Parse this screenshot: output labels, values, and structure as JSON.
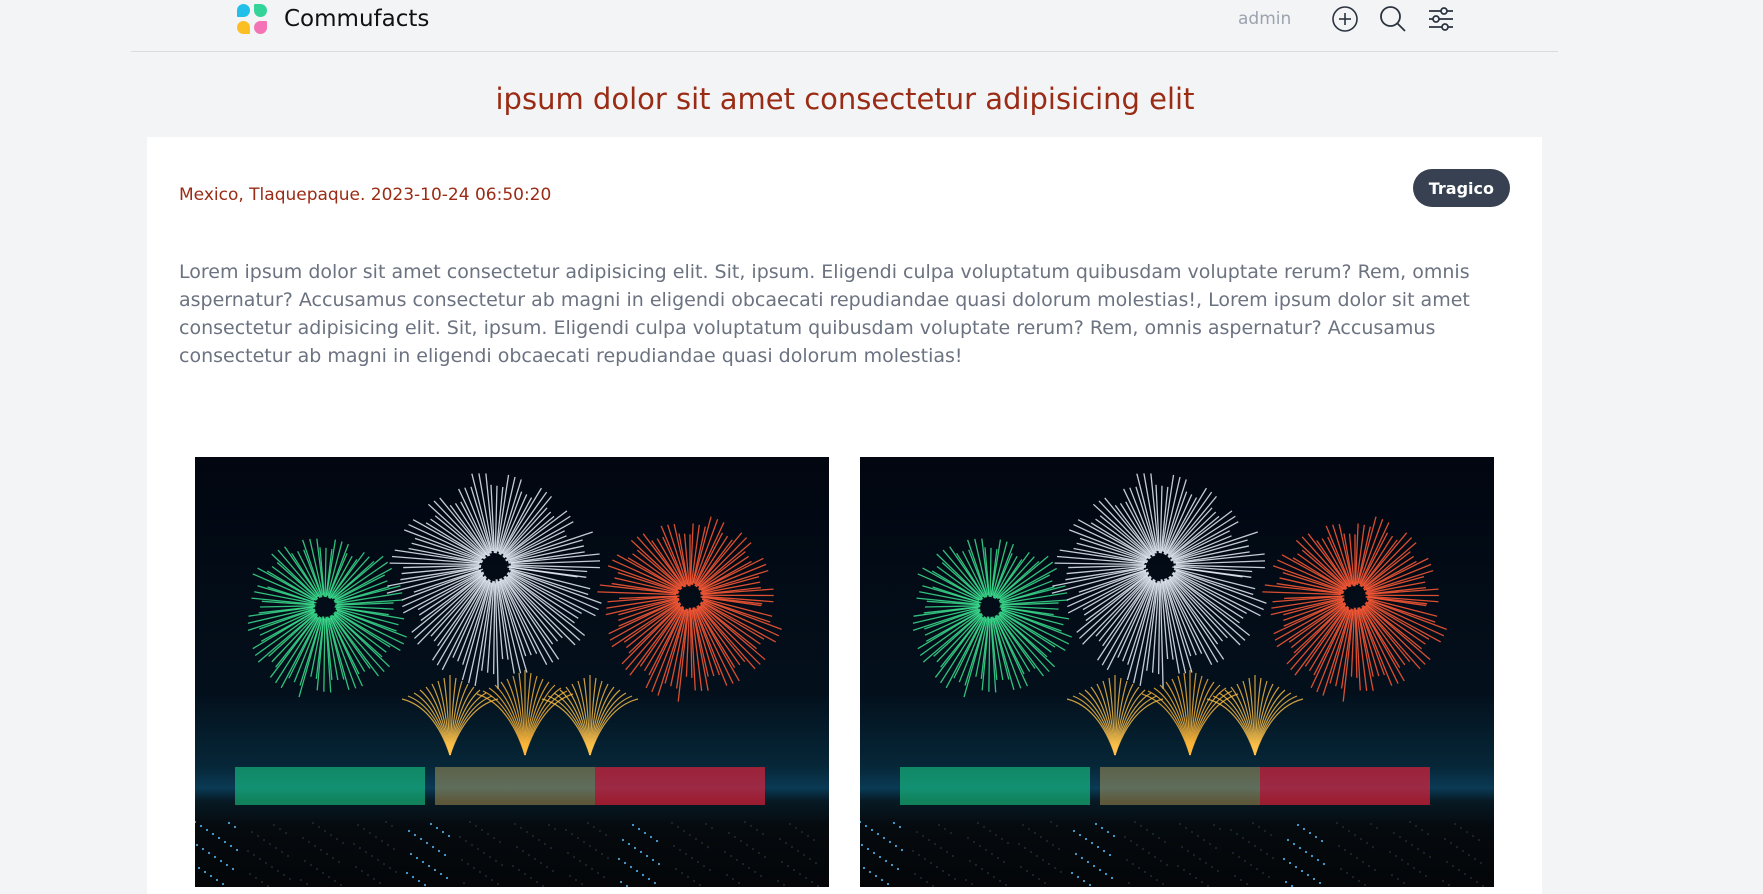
{
  "header": {
    "brand": "Commufacts",
    "user": "admin",
    "icons": [
      "add-circle-icon",
      "search-icon",
      "settings-sliders-icon"
    ]
  },
  "post": {
    "title": "ipsum dolor sit amet consectetur adipisicing elit",
    "meta": "Mexico, Tlaquepaque. 2023-10-24 06:50:20",
    "tag": "Tragico",
    "body": "Lorem ipsum dolor sit amet consectetur adipisicing elit. Sit, ipsum. Eligendi culpa voluptatum quibusdam voluptate rerum? Rem, omnis aspernatur? Accusamus consectetur ab magni in eligendi obcaecati repudiandae quasi dolorum molestias!, Lorem ipsum dolor sit amet consectetur adipisicing elit. Sit, ipsum. Eligendi culpa voluptatum quibusdam voluptate rerum? Rem, omnis aspernatur? Accusamus consectetur ab magni in eligendi obcaecati repudiandae quasi dolorum molestias!",
    "images": [
      "fireworks-photo",
      "fireworks-photo"
    ]
  },
  "colors": {
    "accent": "#9a2b14",
    "badge_bg": "#374151",
    "muted_text": "#6b7280",
    "background": "#f3f4f6"
  }
}
